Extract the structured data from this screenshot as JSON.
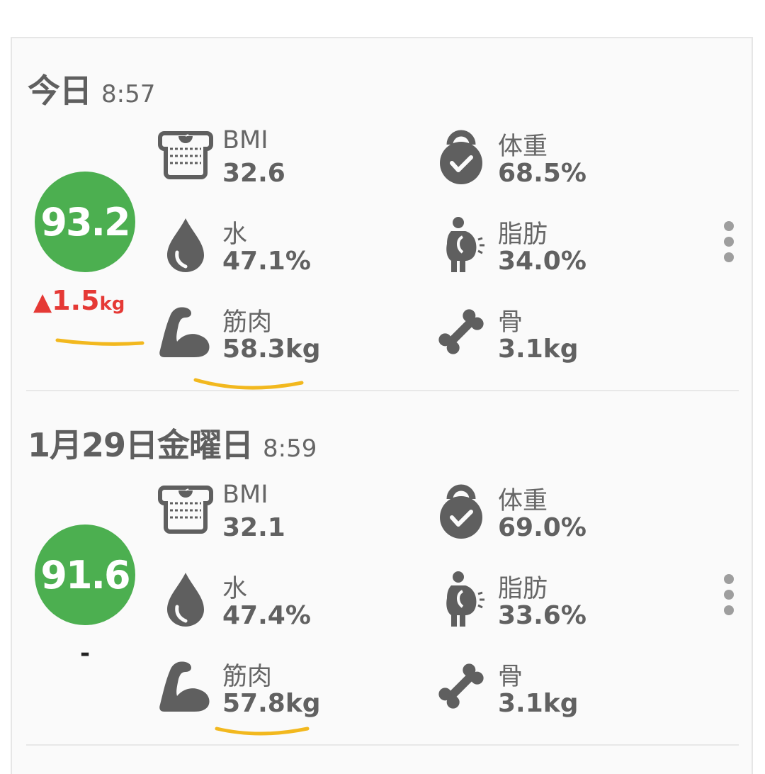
{
  "entries": [
    {
      "date": "今日",
      "time": "8:57",
      "score": "93.2",
      "change": {
        "symbol": "▲",
        "value": "1.5",
        "unit": "kg"
      },
      "metrics": {
        "bmi": {
          "label": "BMI",
          "value": "32.6",
          "icon": "scale-icon"
        },
        "weight": {
          "label": "体重",
          "value": "68.5%",
          "icon": "kettlebell-icon"
        },
        "water": {
          "label": "水",
          "value": "47.1%",
          "icon": "water-drop-icon"
        },
        "fat": {
          "label": "脂肪",
          "value": "34.0%",
          "icon": "body-fat-icon"
        },
        "muscle": {
          "label": "筋肉",
          "value": "58.3kg",
          "icon": "muscle-arm-icon"
        },
        "bone": {
          "label": "骨",
          "value": "3.1kg",
          "icon": "bone-icon"
        }
      }
    },
    {
      "date": "1月29日金曜日",
      "time": "8:59",
      "score": "91.6",
      "change_text": "-",
      "metrics": {
        "bmi": {
          "label": "BMI",
          "value": "32.1",
          "icon": "scale-icon"
        },
        "weight": {
          "label": "体重",
          "value": "69.0%",
          "icon": "kettlebell-icon"
        },
        "water": {
          "label": "水",
          "value": "47.4%",
          "icon": "water-drop-icon"
        },
        "fat": {
          "label": "脂肪",
          "value": "33.6%",
          "icon": "body-fat-icon"
        },
        "muscle": {
          "label": "筋肉",
          "value": "57.8kg",
          "icon": "muscle-arm-icon"
        },
        "bone": {
          "label": "骨",
          "value": "3.1kg",
          "icon": "bone-icon"
        }
      }
    }
  ],
  "colors": {
    "score_circle": "#4caf50",
    "change_up": "#e53935",
    "highlight_marker": "#f2b81e",
    "icon": "#5f5f5f"
  }
}
